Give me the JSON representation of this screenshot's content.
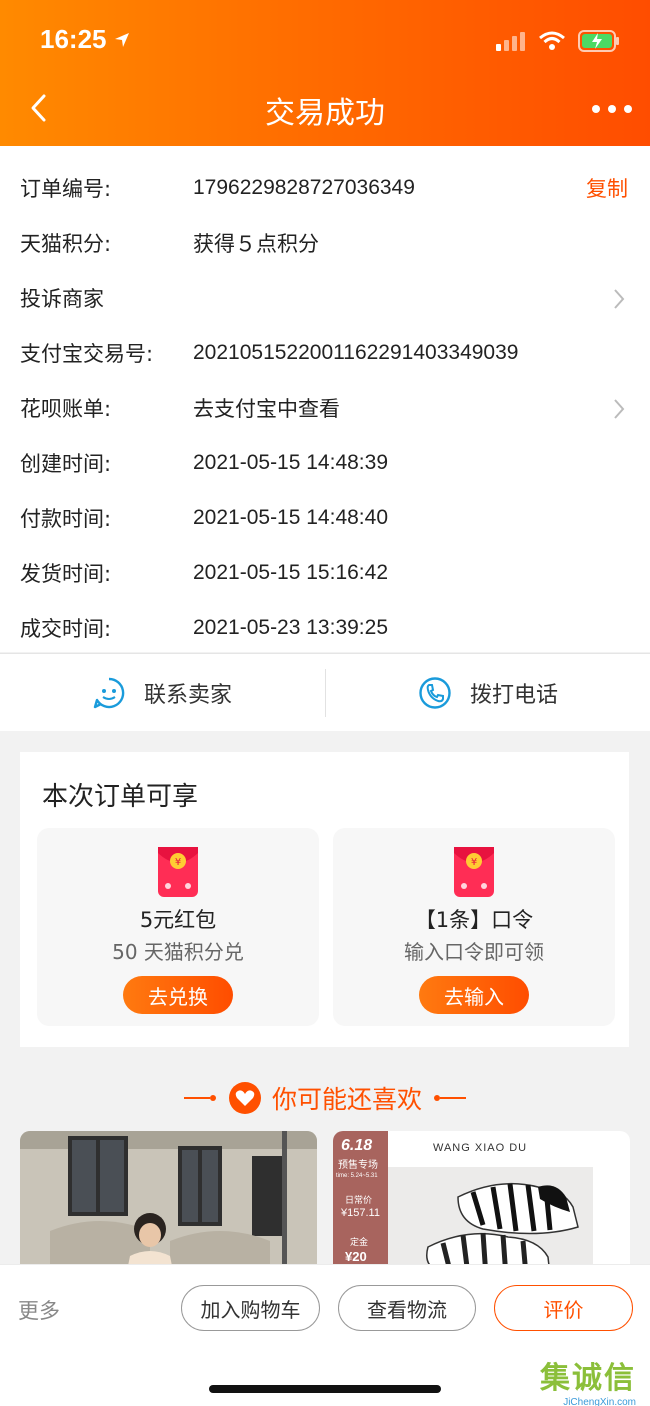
{
  "status": {
    "time": "16:25"
  },
  "nav": {
    "title": "交易成功"
  },
  "order": {
    "rows": [
      {
        "label": "订单编号:",
        "value": "1796229828727036349",
        "action": "复制"
      },
      {
        "label": "天猫积分:",
        "value": "获得５点积分"
      },
      {
        "label": "投诉商家",
        "value": ""
      },
      {
        "label": "支付宝交易号:",
        "value": "2021051522001162291403349039"
      },
      {
        "label": "花呗账单:",
        "value": "去支付宝中查看"
      },
      {
        "label": "创建时间:",
        "value": "2021-05-15 14:48:39"
      },
      {
        "label": "付款时间:",
        "value": "2021-05-15 14:48:40"
      },
      {
        "label": "发货时间:",
        "value": "2021-05-15 15:16:42"
      },
      {
        "label": "成交时间:",
        "value": "2021-05-23 13:39:25"
      }
    ]
  },
  "contact": {
    "seller": "联系卖家",
    "phone": "拨打电话"
  },
  "benefits": {
    "title": "本次订单可享",
    "cards": [
      {
        "title": "5元红包",
        "subtitle": "50 天猫积分兑",
        "button": "去兑换"
      },
      {
        "title": "【1条】口令",
        "subtitle": "输入口令即可领",
        "button": "去输入"
      }
    ]
  },
  "recommend": {
    "title": "你可能还喜欢",
    "promo": {
      "badge": "6.18",
      "badge_sub": "预售专场",
      "time": "time: 5.24~5.31",
      "brand": "WANG XIAO DU",
      "daily_label": "日常价",
      "daily_price": "¥157.11",
      "deposit_label": "定金",
      "deposit_price": "¥20"
    }
  },
  "bottom": {
    "more": "更多",
    "add_cart": "加入购物车",
    "logistics": "查看物流",
    "review": "评价"
  },
  "watermark": {
    "text": "集诚信",
    "url": "JiChengXin.com"
  },
  "colors": {
    "accent": "#ff5000",
    "header_start": "#ff8a00",
    "header_end": "#ff4d00"
  }
}
